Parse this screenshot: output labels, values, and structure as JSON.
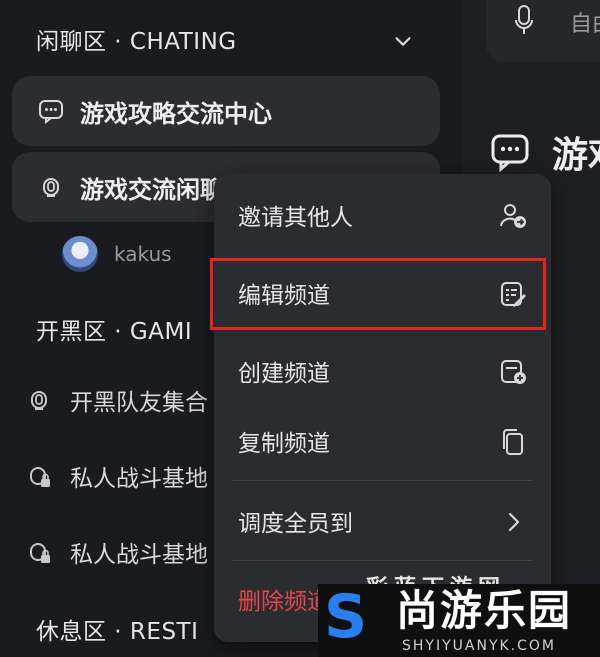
{
  "sidebar": {
    "sections": [
      {
        "label": "闲聊区 · CHATING"
      },
      {
        "label": "开黑区 · GAMI"
      },
      {
        "label": "休息区 · RESTI"
      }
    ],
    "channels": [
      {
        "label": "游戏攻略交流中心",
        "icon": "chat-bubble-icon"
      },
      {
        "label": "游戏交流闲聊",
        "icon": "voice-channel-icon"
      }
    ],
    "member": {
      "name": "kakus"
    },
    "sub_channels": [
      {
        "label": "开黑队友集合",
        "icon": "voice-channel-icon"
      },
      {
        "label": "私人战斗基地",
        "icon": "locked-voice-channel-icon"
      },
      {
        "label": "私人战斗基地",
        "icon": "locked-voice-channel-icon"
      }
    ]
  },
  "topbar": {
    "text": "自由"
  },
  "main": {
    "title": "游戏"
  },
  "context_menu": {
    "items": [
      {
        "label": "邀请其他人",
        "icon": "invite-user-icon"
      },
      {
        "label": "编辑频道",
        "icon": "edit-channel-icon"
      },
      {
        "label": "创建频道",
        "icon": "create-channel-icon"
      },
      {
        "label": "复制频道",
        "icon": "copy-icon"
      },
      {
        "label": "调度全员到",
        "icon": "chevron-right-icon"
      },
      {
        "label": "删除频道",
        "icon": ""
      }
    ]
  },
  "watermark": {
    "letter": "S",
    "main": "尚游乐园",
    "sub": "SHYIYUANYK.COM",
    "top": "彩蓝下游网"
  },
  "colors": {
    "highlight": "#e3261f",
    "danger": "#e0484a",
    "watermark_blue": "#2a7ff0"
  }
}
